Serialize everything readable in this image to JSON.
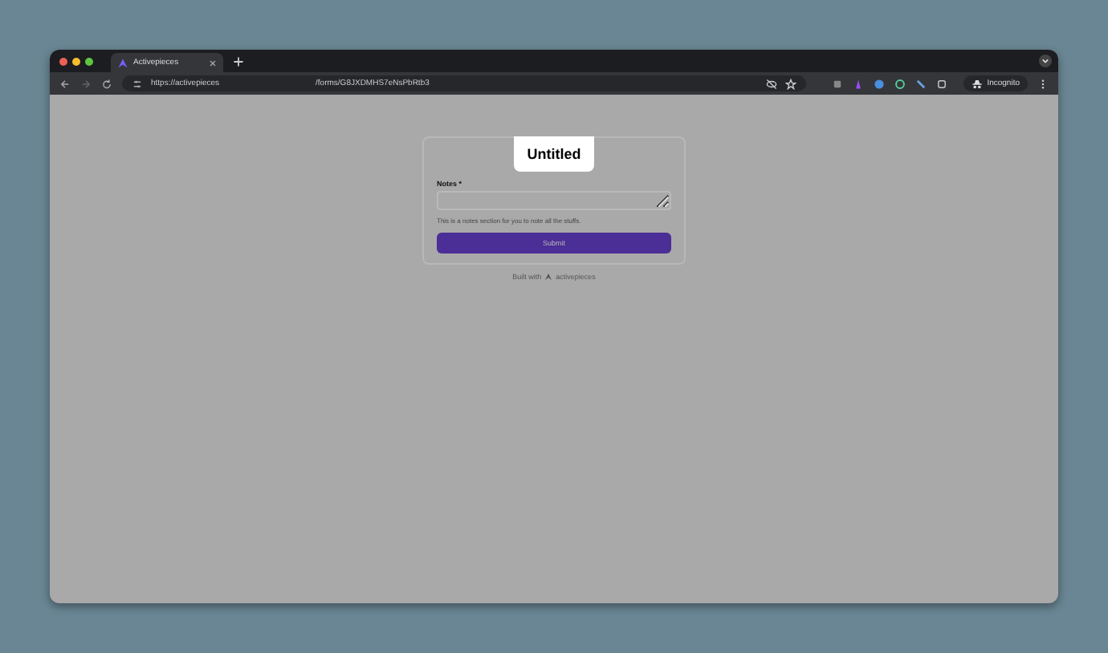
{
  "browser": {
    "tab_title": "Activepieces",
    "url_host": "https://activepieces",
    "url_path": "/forms/G8JXDMHS7eNsPbRtb3",
    "profile": "Incognito"
  },
  "form": {
    "title": "Untitled",
    "fields": [
      {
        "label": "Notes *",
        "hint": "This is a notes section for you to note all the stuffs."
      }
    ],
    "submit": "Submit"
  },
  "footer": {
    "prefix": "Built with",
    "brand": "activepieces"
  }
}
